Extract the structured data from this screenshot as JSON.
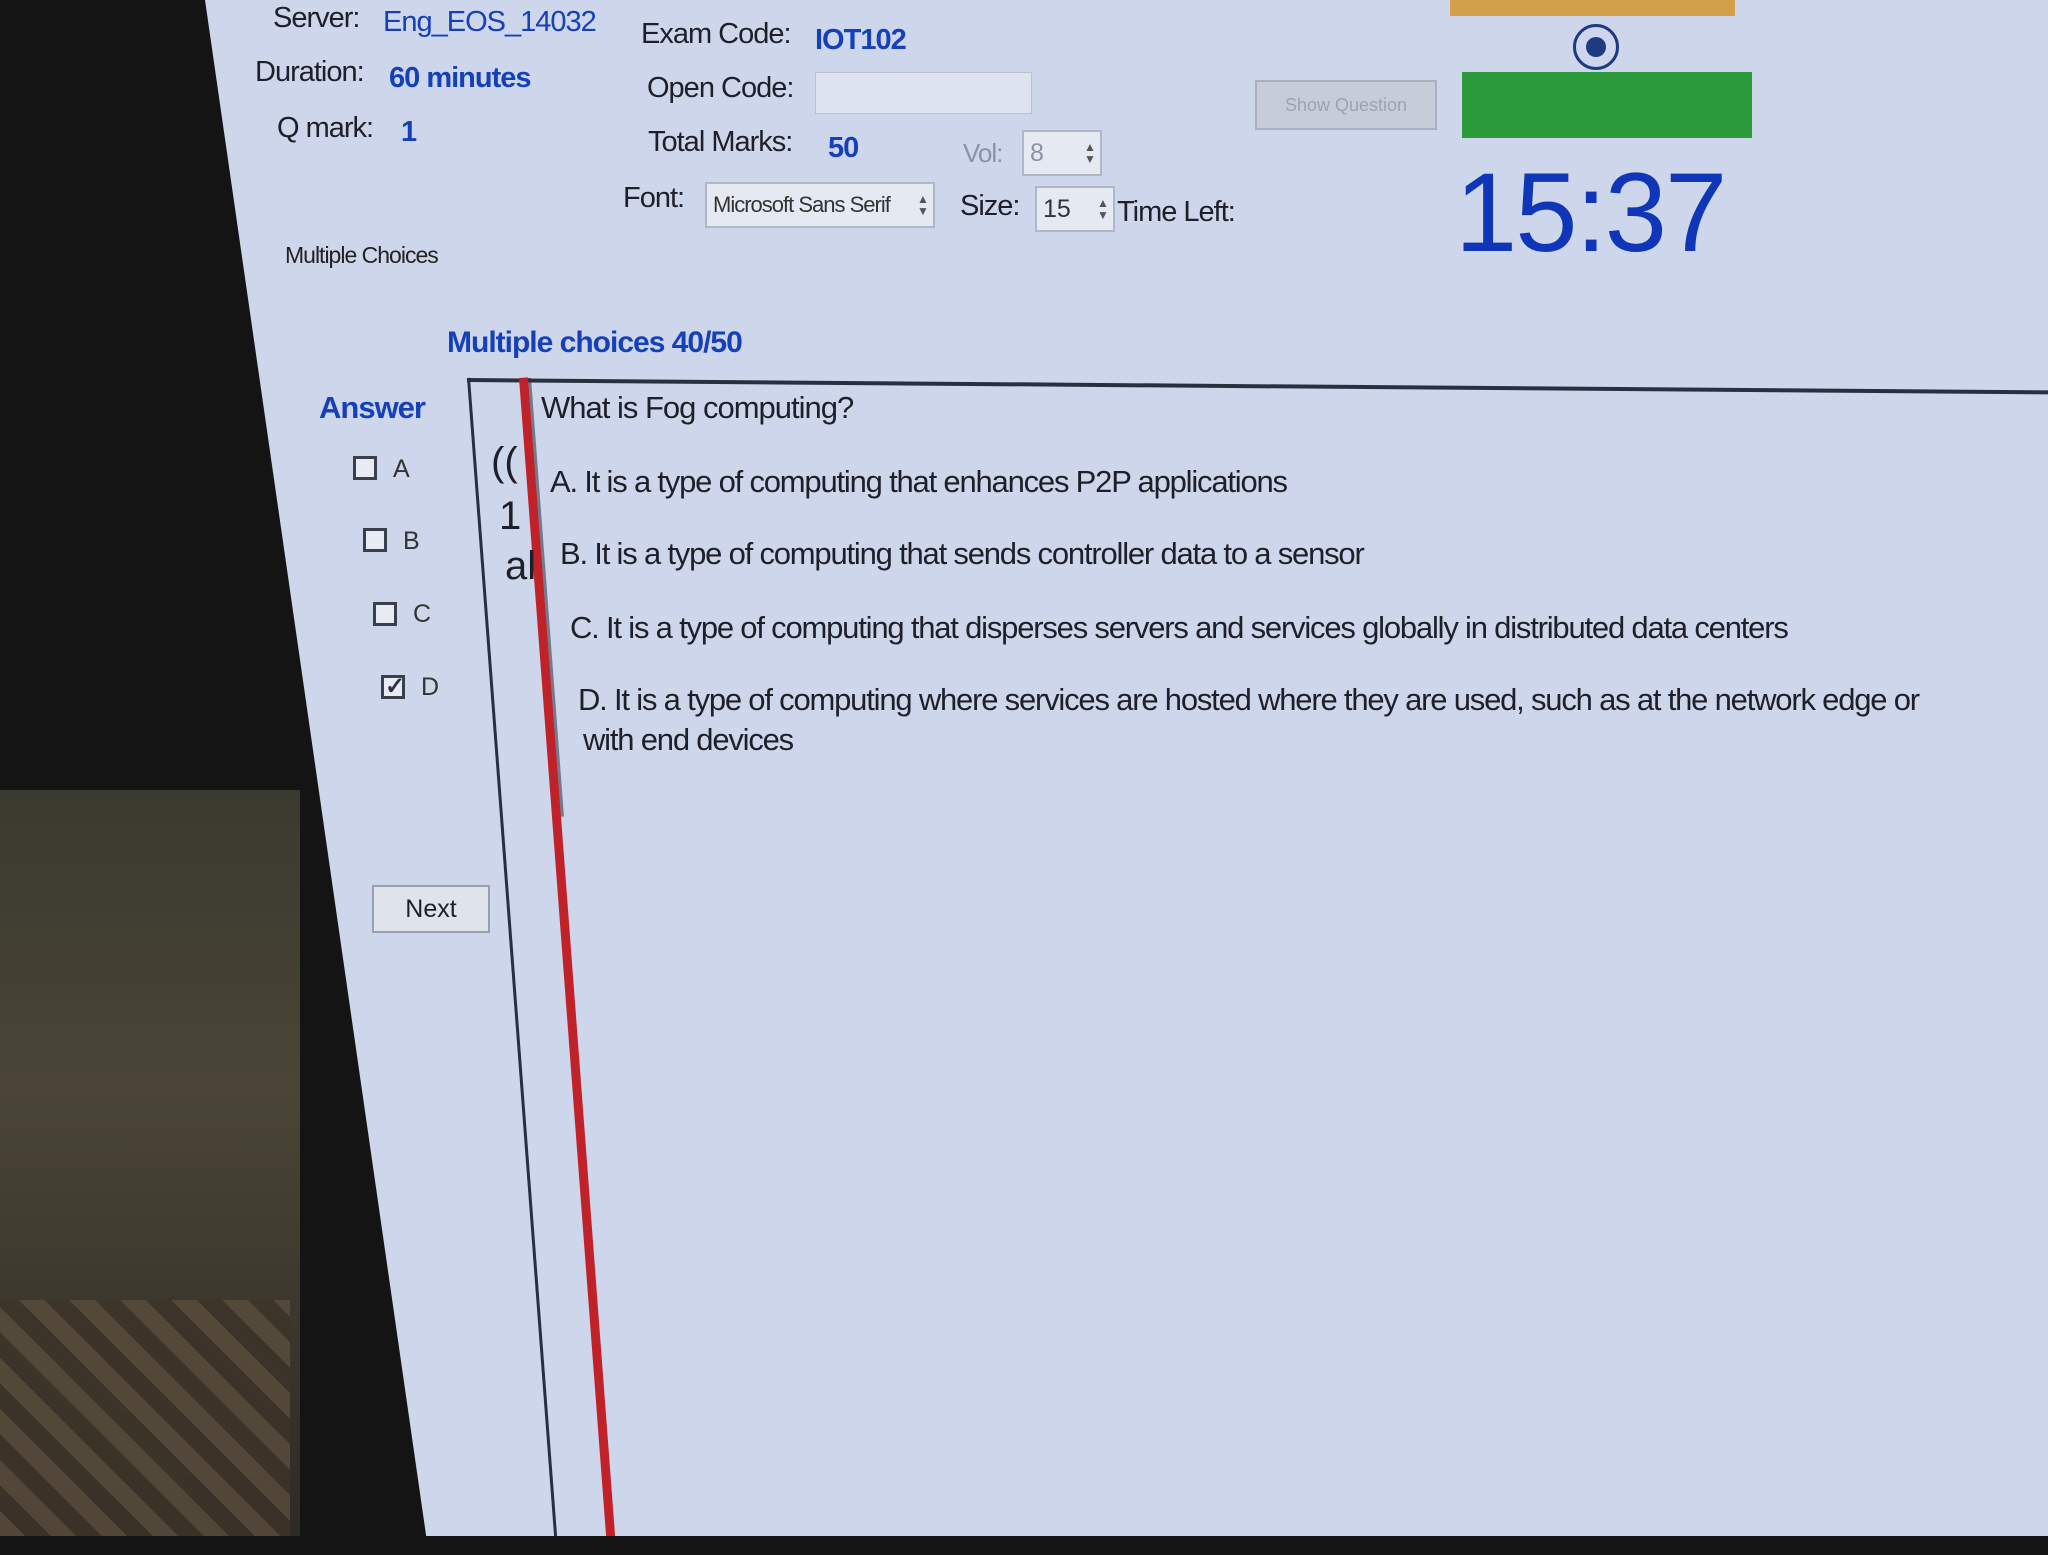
{
  "header": {
    "server_label": "Server:",
    "server_value": "Eng_EOS_14032",
    "exam_code_label": "Exam Code:",
    "exam_code_value": "IOT102",
    "duration_label": "Duration:",
    "duration_value": "60 minutes",
    "open_code_label": "Open Code:",
    "open_code_value": "",
    "show_question_label": "Show Question",
    "qmark_label": "Q mark:",
    "qmark_value": "1",
    "total_marks_label": "Total Marks:",
    "total_marks_value": "50",
    "vol_label": "Vol:",
    "vol_value": "8",
    "font_label": "Font:",
    "font_value": "Microsoft Sans Serif",
    "size_label": "Size:",
    "size_value": "15",
    "time_left_label": "Time Left:",
    "time_left_value": "15:37",
    "section_label": "Multiple Choices"
  },
  "colors": {
    "accent": "#1540b8",
    "timer": "#0f36b8",
    "green_status": "#2a9a3a",
    "orange_bar": "#d2a04b",
    "divider_red": "#c1222a"
  },
  "question_panel": {
    "progress_title": "Multiple choices 40/50",
    "answer_title": "Answer",
    "choices": [
      {
        "letter": "A",
        "checked": false
      },
      {
        "letter": "B",
        "checked": false
      },
      {
        "letter": "C",
        "checked": false
      },
      {
        "letter": "D",
        "checked": true
      }
    ],
    "next_label": "Next",
    "side_fragments": [
      "((",
      "1",
      "al"
    ],
    "question_text": "What is Fog computing?",
    "options": [
      "A.  It is a type of computing that enhances P2P applications",
      "B.  It is a type of computing that sends controller data to a sensor",
      "C.  It is a type of computing that disperses servers and services globally in distributed data centers",
      "D.  It is a type of computing where services are hosted where they are used, such as at the network edge or",
      "with end devices"
    ]
  }
}
